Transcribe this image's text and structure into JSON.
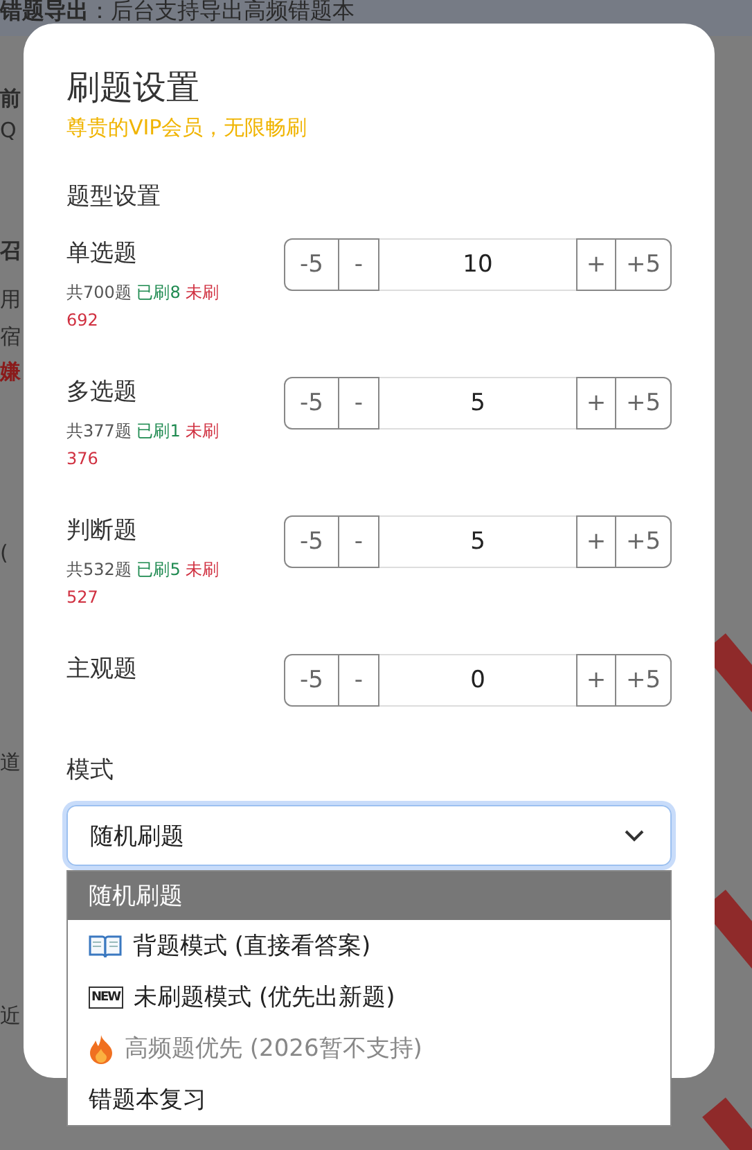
{
  "background": {
    "notice": "**错题导出**：后台支持导出高频错题本",
    "fragments": [
      {
        "text": "前",
        "kind": "bold"
      },
      {
        "text": "Q",
        "kind": "plain"
      },
      {
        "text": "召",
        "kind": "bold"
      },
      {
        "text": "用",
        "kind": "plain"
      },
      {
        "text": "宿",
        "kind": "plain"
      },
      {
        "text": "嫌",
        "kind": "alert"
      },
      {
        "text": "(",
        "kind": "plain"
      },
      {
        "text": "道",
        "kind": "plain"
      },
      {
        "text": "近",
        "kind": "plain"
      }
    ]
  },
  "dialog": {
    "title": "刷题设置",
    "subtitle": "尊贵的VIP会员，无限畅刷",
    "section": "题型设置",
    "types": [
      {
        "name": "单选题",
        "total": "共700题",
        "done": "已刷8",
        "todo": "未刷692",
        "dec": [
          "-5",
          "-"
        ],
        "value": "10",
        "inc": [
          "+",
          "+5"
        ]
      },
      {
        "name": "多选题",
        "total": "共377题",
        "done": "已刷1",
        "todo": "未刷376",
        "dec": [
          "-5",
          "-"
        ],
        "value": "5",
        "inc": [
          "+",
          "+5"
        ]
      },
      {
        "name": "判断题",
        "total": "共532题",
        "done": "已刷5",
        "todo": "未刷527",
        "dec": [
          "-5",
          "-"
        ],
        "value": "5",
        "inc": [
          "+",
          "+5"
        ]
      },
      {
        "name": "主观题",
        "dec": [
          "-5",
          "-"
        ],
        "value": "0",
        "inc": [
          "+",
          "+5"
        ]
      }
    ],
    "mode_label": "模式",
    "select": {
      "value": "随机刷题",
      "focused": true
    },
    "options": [
      {
        "label": "随机刷题",
        "selected": true,
        "disabled": false
      },
      {
        "kind": "book",
        "label": "背题模式 (直接看答案)",
        "selected": false,
        "disabled": false
      },
      {
        "kind": "new",
        "badge": "NEW",
        "label": "未刷题模式 (优先出新题)",
        "selected": false,
        "disabled": false
      },
      {
        "kind": "fire",
        "label": "高频题优先 (2026暂不支持)",
        "selected": false,
        "disabled": true
      },
      {
        "label": "错题本复习",
        "selected": false,
        "disabled": false
      }
    ]
  }
}
